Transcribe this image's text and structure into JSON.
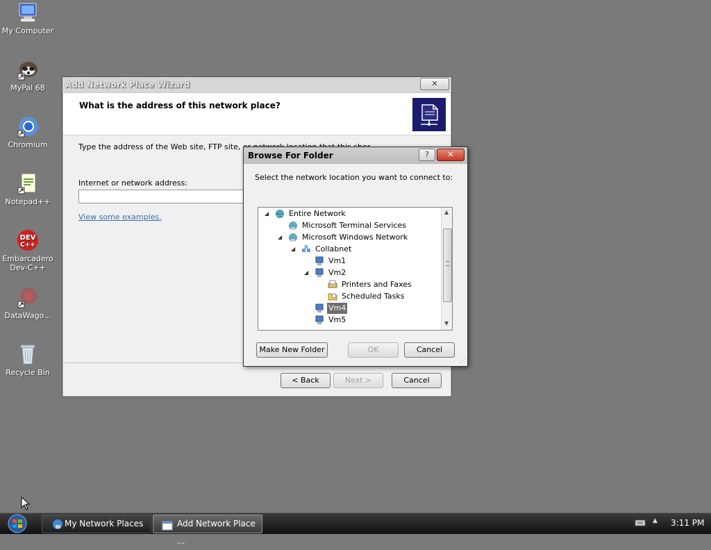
{
  "desktop": {
    "icons": [
      {
        "label": "My Computer",
        "icon": "computer-icon"
      },
      {
        "label": "MyPal 68",
        "icon": "raccoon-icon"
      },
      {
        "label": "Chromium",
        "icon": "chromium-icon"
      },
      {
        "label": "Notepad++",
        "icon": "notepad-icon"
      },
      {
        "label": "Embarcadero Dev-C++",
        "label_line1": "Embarcadero",
        "label_line2": "Dev-C++",
        "icon": "devcpp-icon"
      },
      {
        "label": "DataWago...",
        "icon": "datawagon-icon"
      },
      {
        "label": "Recycle Bin",
        "icon": "recycle-bin-icon"
      }
    ]
  },
  "wizard": {
    "title": "Add Network Place Wizard",
    "heading": "What is the address of this network place?",
    "description": "Type the address of the Web site, FTP site, or network location that this shortcut will open.",
    "address_label": "Internet or network address:",
    "address_value": "",
    "examples_link": "View some examples.",
    "back_label": "< Back",
    "next_label": "Next >",
    "cancel_label": "Cancel"
  },
  "browse": {
    "title": "Browse For Folder",
    "help_label": "?",
    "close_label": "✕",
    "instruction": "Select the network location you want to connect to:",
    "tree": [
      {
        "label": "Entire Network",
        "icon": "globe-icon",
        "expanded": true,
        "selected": false
      },
      {
        "label": "Microsoft Terminal Services",
        "icon": "network-globe-icon",
        "expanded": false,
        "selected": false
      },
      {
        "label": "Microsoft Windows Network",
        "icon": "network-globe-icon",
        "expanded": true,
        "selected": false
      },
      {
        "label": "Collabnet",
        "icon": "workgroup-icon",
        "expanded": true,
        "selected": false
      },
      {
        "label": "Vm1",
        "icon": "computer-icon",
        "expanded": false,
        "selected": false
      },
      {
        "label": "Vm2",
        "icon": "computer-icon",
        "expanded": true,
        "selected": false
      },
      {
        "label": "Printers and Faxes",
        "icon": "printer-icon",
        "expanded": false,
        "selected": false
      },
      {
        "label": "Scheduled Tasks",
        "icon": "folder-icon",
        "expanded": false,
        "selected": false
      },
      {
        "label": "Vm4",
        "icon": "computer-icon",
        "expanded": false,
        "selected": true
      },
      {
        "label": "Vm5",
        "icon": "computer-icon",
        "expanded": false,
        "selected": false
      }
    ],
    "make_folder_label": "Make New Folder",
    "ok_label": "OK",
    "cancel_label": "Cancel"
  },
  "taskbar": {
    "tasks": [
      {
        "label": "My Network Places",
        "active": false
      },
      {
        "label": "Add Network Place ...",
        "active": true
      }
    ],
    "time": "3:11 PM"
  }
}
